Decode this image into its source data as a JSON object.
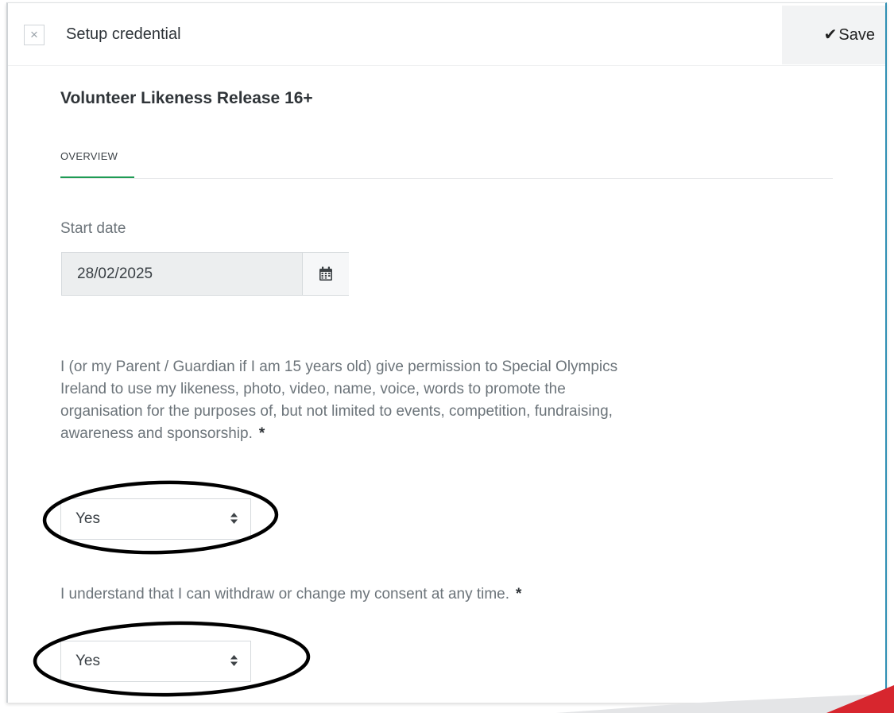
{
  "header": {
    "close_glyph": "×",
    "title": "Setup credential",
    "save_label": "Save",
    "save_icon": "check-icon"
  },
  "credential": {
    "title": "Volunteer Likeness Release 16+"
  },
  "tabs": [
    {
      "label": "OVERVIEW",
      "active": true
    }
  ],
  "start_date": {
    "label": "Start date",
    "value": "28/02/2025",
    "icon": "calendar-icon"
  },
  "questions": [
    {
      "text": "I (or my Parent / Guardian if I am 15 years old) give permission to Special Olympics Ireland to use my likeness, photo, video, name, voice, words to promote the organisation for the purposes of, but not limited to events, competition, fundraising, awareness and sponsorship.",
      "required_mark": "*",
      "selected": "Yes"
    },
    {
      "text": "I understand that I can withdraw or change my consent at any time.",
      "required_mark": "*",
      "selected": "Yes"
    }
  ],
  "colors": {
    "tab_accent": "#1f9b54",
    "panel_border": "#2f8fb3",
    "annotation": "#000000",
    "corner_accent": "#d7262e"
  }
}
